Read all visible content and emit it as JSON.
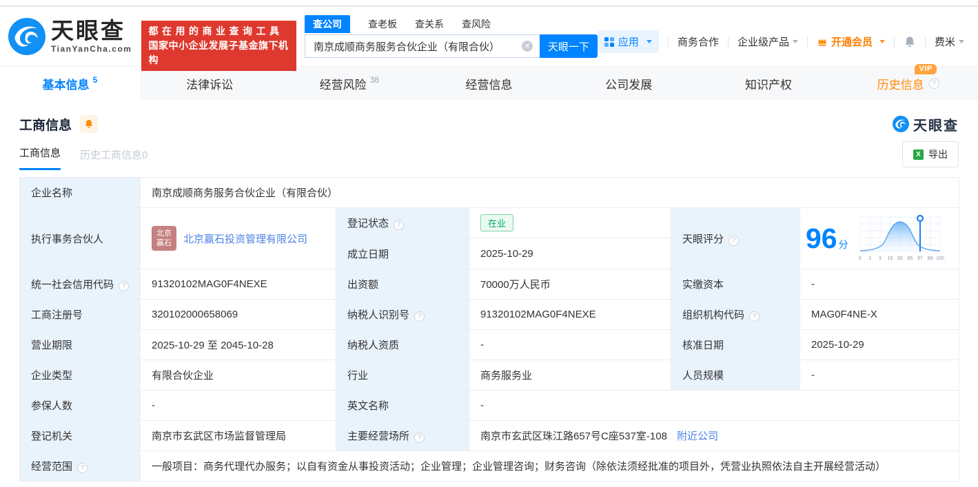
{
  "colors": {
    "primary_blue": "#0084FF",
    "banner_red": "#DE392E",
    "vip_orange": "#FF8A00",
    "status_green": "#00A862",
    "link_blue": "#4E83E8",
    "label_cell_bg": "#E9F3FC"
  },
  "header": {
    "logo_name": "天眼查",
    "logo_domain": "TianYanCha.com",
    "slogan_line1": "都在用的商业查询工具",
    "slogan_line2": "国家中小企业发展子基金旗下机构",
    "search_tabs": [
      "查公司",
      "查老板",
      "查关系",
      "查风险"
    ],
    "search_value": "南京成顺商务服务合伙企业（有限合伙）",
    "search_button": "天眼一下",
    "menu_apps": "应用",
    "menu_cooperation": "商务合作",
    "menu_enterprise": "企业级产品",
    "menu_vip": "开通会员",
    "menu_user": "费米"
  },
  "main_tabs": [
    {
      "label": "基本信息",
      "badge": "5"
    },
    {
      "label": "法律诉讼"
    },
    {
      "label": "经营风险",
      "badge": "38"
    },
    {
      "label": "经营信息"
    },
    {
      "label": "公司发展"
    },
    {
      "label": "知识产权"
    },
    {
      "label": "历史信息",
      "vip_badge": "VIP"
    }
  ],
  "section": {
    "title": "工商信息",
    "brand_logo": "天眼查",
    "subtab_active": "工商信息",
    "subtab_history": "历史工商信息0",
    "export_button": "导出"
  },
  "business_info": {
    "fields": {
      "company_name": {
        "label": "企业名称",
        "value": "南京成顺商务服务合伙企业（有限合伙）"
      },
      "executive_partner": {
        "label": "执行事务合伙人",
        "avatar": "北京赢石",
        "value": "北京赢石投资管理有限公司"
      },
      "registration_status": {
        "label": "登记状态",
        "value": "在业"
      },
      "establishment_date": {
        "label": "成立日期",
        "value": "2025-10-29"
      },
      "tianyan_score": {
        "label": "天眼评分"
      },
      "credit_code": {
        "label": "统一社会信用代码",
        "value": "91320102MAG0F4NEXE"
      },
      "contribution_amount": {
        "label": "出资额",
        "value": "70000万人民币"
      },
      "paid_in_capital": {
        "label": "实缴资本",
        "value": "-"
      },
      "registration_number": {
        "label": "工商注册号",
        "value": "320102000658069"
      },
      "taxpayer_id": {
        "label": "纳税人识别号",
        "value": "91320102MAG0F4NEXE"
      },
      "organization_code": {
        "label": "组织机构代码",
        "value": "MAG0F4NE-X"
      },
      "business_term": {
        "label": "营业期限",
        "value": "2025-10-29 至 2045-10-28"
      },
      "taxpayer_qualification": {
        "label": "纳税人资质",
        "value": "-"
      },
      "approval_date": {
        "label": "核准日期",
        "value": "2025-10-29"
      },
      "company_type": {
        "label": "企业类型",
        "value": "有限合伙企业"
      },
      "industry": {
        "label": "行业",
        "value": "商务服务业"
      },
      "staff_size": {
        "label": "人员规模",
        "value": "-"
      },
      "insured_count": {
        "label": "参保人数",
        "value": "-"
      },
      "english_name": {
        "label": "英文名称",
        "value": "-"
      },
      "registration_authority": {
        "label": "登记机关",
        "value": "南京市玄武区市场监督管理局"
      },
      "business_premises": {
        "label": "主要经营场所",
        "value": "南京市玄武区珠江路657号C座537室-108",
        "link": "附近公司"
      },
      "business_scope": {
        "label": "经营范围",
        "value": "一般项目：商务代理代办服务；以自有资金从事投资活动；企业管理；企业管理咨询；财务咨询（除依法须经批准的项目外，凭营业执照依法自主开展经营活动）"
      }
    }
  },
  "chart_data": {
    "type": "area",
    "title": "天眼评分",
    "score": "96",
    "unit": "分",
    "x_ticks": [
      "0",
      "1",
      "3",
      "15",
      "50",
      "85",
      "97",
      "99",
      "100"
    ],
    "marker_x": "97",
    "shape": "bell-curve score distribution, peak at tick 50, marker pin at tick 97",
    "accent": "#1E7FE8",
    "grid": true
  }
}
